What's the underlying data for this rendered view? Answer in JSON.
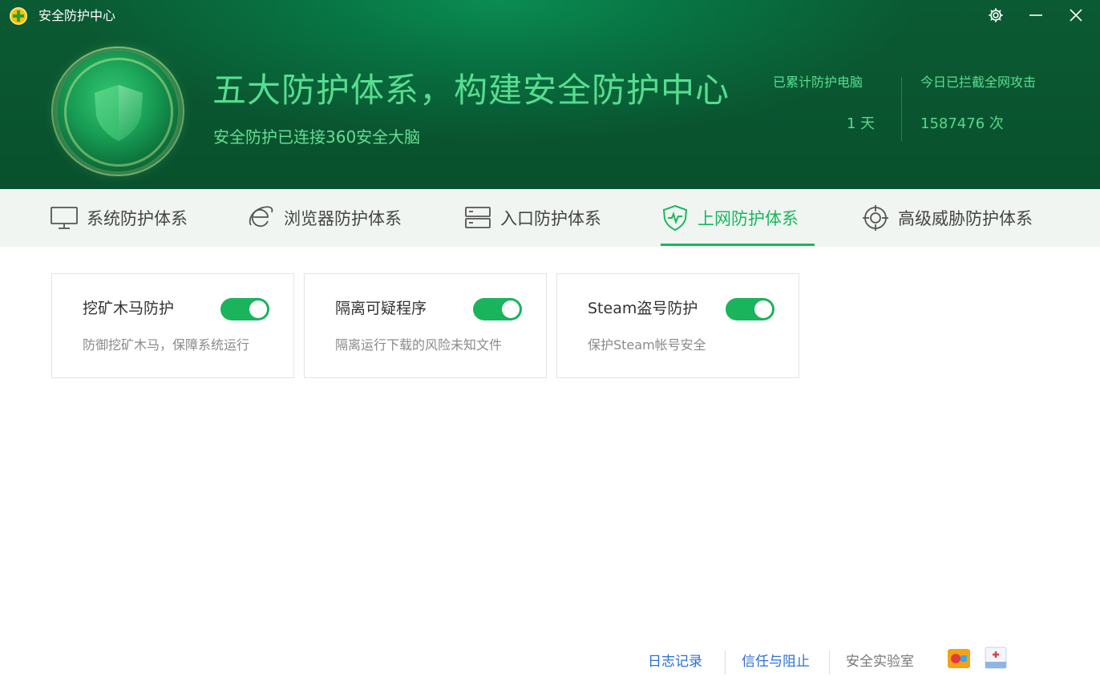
{
  "window": {
    "title": "安全防护中心",
    "controls": [
      "settings",
      "minimize",
      "close"
    ]
  },
  "header": {
    "headline": "五大防护体系，构建安全防护中心",
    "subline": "安全防护已连接360安全大脑",
    "stats": [
      {
        "label": "已累计防护电脑",
        "value": "1 天"
      },
      {
        "label": "今日已拦截全网攻击",
        "value": "1587476 次"
      }
    ],
    "colors": {
      "accent": "#5ce896",
      "bg": "#087443"
    }
  },
  "tabs": [
    {
      "label": "系统防护体系",
      "icon": "monitor-icon",
      "active": false
    },
    {
      "label": "浏览器防护体系",
      "icon": "browser-e-icon",
      "active": false
    },
    {
      "label": "入口防护体系",
      "icon": "server-icon",
      "active": false
    },
    {
      "label": "上网防护体系",
      "icon": "shield-pulse-icon",
      "active": true
    },
    {
      "label": "高级威胁防护体系",
      "icon": "crosshair-icon",
      "active": false
    }
  ],
  "cards": [
    {
      "title": "挖矿木马防护",
      "desc": "防御挖矿木马，保障系统运行",
      "enabled": true
    },
    {
      "title": "隔离可疑程序",
      "desc": "隔离运行下载的风险未知文件",
      "enabled": true
    },
    {
      "title": "Steam盗号防护",
      "desc": "保护Steam帐号安全",
      "enabled": true
    }
  ],
  "footer": {
    "links": [
      {
        "label": "日志记录",
        "color": "#2a6fd6"
      },
      {
        "label": "信任与阻止",
        "color": "#2a6fd6"
      },
      {
        "label": "安全实验室",
        "color": "#777777"
      }
    ],
    "icons": [
      "game-icon",
      "first-aid-kit-icon"
    ]
  },
  "colors": {
    "primary_green": "#17b85f",
    "toggle_on": "#19b45c"
  }
}
